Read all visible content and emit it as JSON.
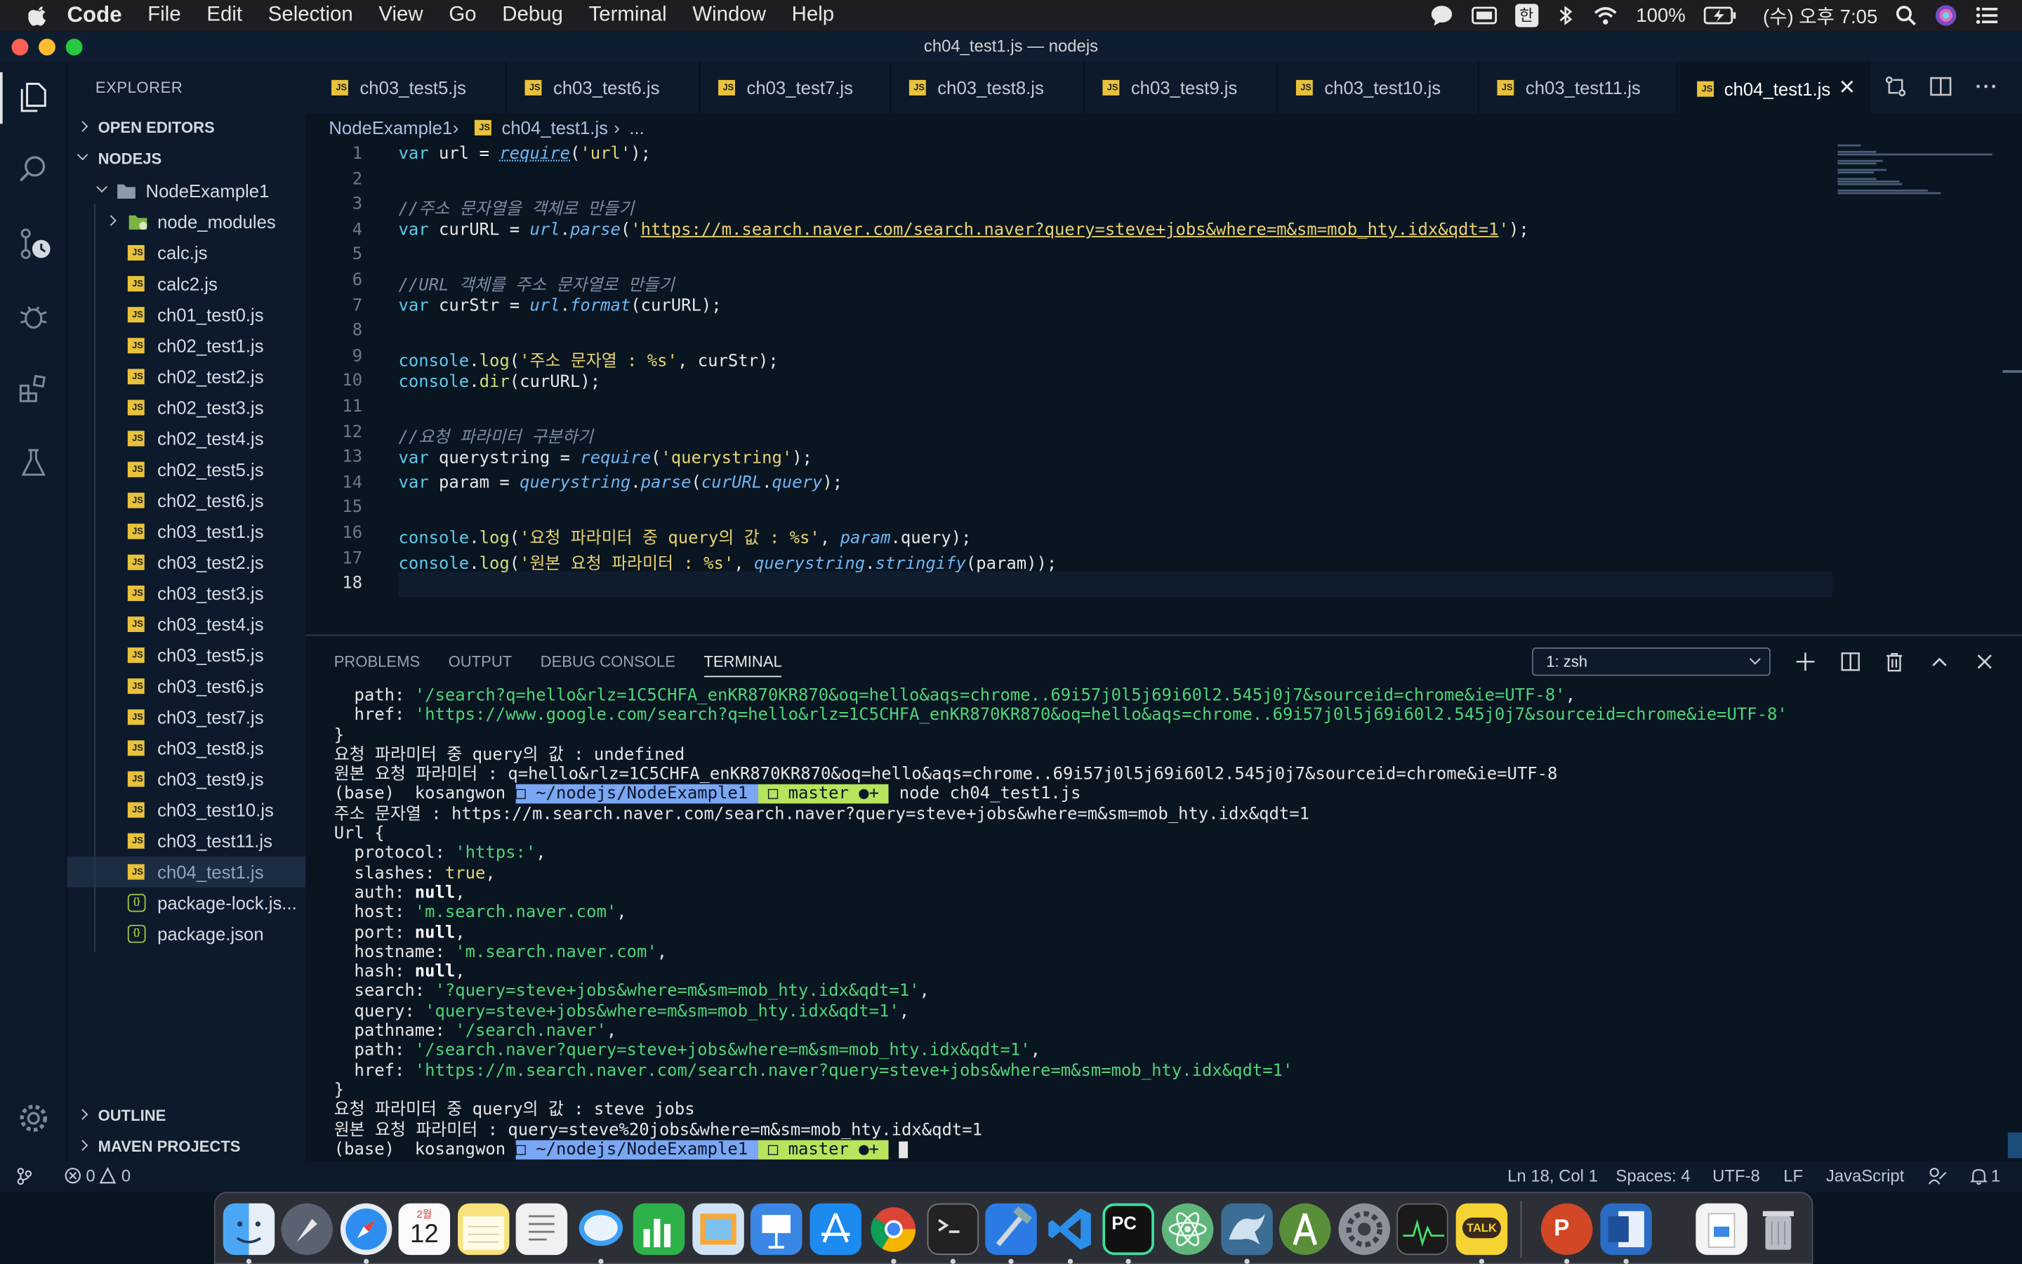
{
  "menubar": {
    "app": "Code",
    "items": [
      "File",
      "Edit",
      "Selection",
      "View",
      "Go",
      "Debug",
      "Terminal",
      "Window",
      "Help"
    ],
    "battery": "100%",
    "datetime": "(수) 오후 7:05",
    "ime": "한"
  },
  "window": {
    "title": "ch04_test1.js — nodejs"
  },
  "explorer": {
    "title": "EXPLORER",
    "open_editors": "OPEN EDITORS",
    "workspace": "NODEJS",
    "project": "NodeExample1",
    "folder": "node_modules",
    "files": [
      "calc.js",
      "calc2.js",
      "ch01_test0.js",
      "ch02_test1.js",
      "ch02_test2.js",
      "ch02_test3.js",
      "ch02_test4.js",
      "ch02_test5.js",
      "ch02_test6.js",
      "ch03_test1.js",
      "ch03_test2.js",
      "ch03_test3.js",
      "ch03_test4.js",
      "ch03_test5.js",
      "ch03_test6.js",
      "ch03_test7.js",
      "ch03_test8.js",
      "ch03_test9.js",
      "ch03_test10.js",
      "ch03_test11.js",
      "ch04_test1.js"
    ],
    "json_files": [
      "package-lock.js...",
      "package.json"
    ],
    "outline": "OUTLINE",
    "maven": "MAVEN PROJECTS"
  },
  "tabs": [
    "ch03_test5.js",
    "ch03_test6.js",
    "ch03_test7.js",
    "ch03_test8.js",
    "ch03_test9.js",
    "ch03_test10.js",
    "ch03_test11.js",
    "ch04_test1.js"
  ],
  "breadcrumb": {
    "project": "NodeExample1",
    "file": "ch04_test1.js",
    "rest": "..."
  },
  "editor": {
    "line_numbers": [
      "1",
      "2",
      "3",
      "4",
      "5",
      "6",
      "7",
      "8",
      "9",
      "10",
      "11",
      "12",
      "13",
      "14",
      "15",
      "16",
      "17",
      "18"
    ]
  },
  "panel": {
    "tabs": [
      "PROBLEMS",
      "OUTPUT",
      "DEBUG CONSOLE",
      "TERMINAL"
    ],
    "terminal_select": "1: zsh"
  },
  "terminal": {
    "prompt_base": "(base)  kosangwon ",
    "prompt_path": "□ ~/nodejs/NodeExample1 ",
    "prompt_git": " □ master ●+ ",
    "command": "node ch04_test1.js",
    "l1_key": "  path: ",
    "l1_val": "'/search?q=hello&rlz=1C5CHFA_enKR870KR870&oq=hello&aqs=chrome..69i57j0l5j69i60l2.545j0j7&sourceid=chrome&ie=UTF-8'",
    "l1_end": ",",
    "l2_key": "  href: ",
    "l2_val": "'https://www.google.com/search?q=hello&rlz=1C5CHFA_enKR870KR870&oq=hello&aqs=chrome..69i57j0l5j69i60l2.545j0j7&sourceid=chrome&ie=UTF-8'",
    "l3": "}",
    "l4": "요청 파라미터 중 query의 값 : undefined",
    "l5": "원본 요청 파라미터 : q=hello&rlz=1C5CHFA_enKR870KR870&oq=hello&aqs=chrome..69i57j0l5j69i60l2.545j0j7&sourceid=chrome&ie=UTF-8",
    "l7": "주소 문자열 : https://m.search.naver.com/search.naver?query=steve+jobs&where=m&sm=mob_hty.idx&qdt=1",
    "l8": "Url {",
    "protocol_k": "  protocol: ",
    "protocol_v": "'https:'",
    "slashes_k": "  slashes: ",
    "slashes_v": "true",
    "auth_k": "  auth: ",
    "null_v": "null",
    "host_k": "  host: ",
    "host_v": "'m.search.naver.com'",
    "port_k": "  port: ",
    "hostname_k": "  hostname: ",
    "hostname_v": "'m.search.naver.com'",
    "hash_k": "  hash: ",
    "search_k": "  search: ",
    "search_v": "'?query=steve+jobs&where=m&sm=mob_hty.idx&qdt=1'",
    "query_k": "  query: ",
    "query_v": "'query=steve+jobs&where=m&sm=mob_hty.idx&qdt=1'",
    "pathname_k": "  pathname: ",
    "pathname_v": "'/search.naver'",
    "path_k": "  path: ",
    "path_v": "'/search.naver?query=steve+jobs&where=m&sm=mob_hty.idx&qdt=1'",
    "href_k": "  href: ",
    "href_v": "'https://m.search.naver.com/search.naver?query=steve+jobs&where=m&sm=mob_hty.idx&qdt=1'",
    "l20": "}",
    "l21": "요청 파라미터 중 query의 값 : steve jobs",
    "l22": "원본 요청 파라미터 : query=steve%20jobs&where=m&sm=mob_hty.idx&qdt=1"
  },
  "status": {
    "errors": "0",
    "warnings": "0",
    "position": "Ln 18, Col 1",
    "spaces": "Spaces: 4",
    "encoding": "UTF-8",
    "eol": "LF",
    "language": "JavaScript",
    "notifications": "1"
  },
  "colors": {
    "accent": "#e8c23a",
    "terminal_green": "#4fd477",
    "prompt_path": "#7aa6f3",
    "prompt_git": "#b8e35d",
    "background": "#0a1522"
  },
  "dock_icons": [
    "finder-icon",
    "launchpad-icon",
    "safari-icon",
    "calendar-icon",
    "notes-icon",
    "textedit-icon",
    "messages-icon",
    "numbers-icon",
    "preview-icon",
    "keynote-icon",
    "app-store-icon",
    "chrome-icon",
    "terminal-icon",
    "xcode-icon",
    "vscode-icon",
    "pycharm-icon",
    "atom-icon",
    "mysql-workbench-icon",
    "android-studio-icon",
    "system-preferences-icon",
    "activity-monitor-icon",
    "kakaotalk-icon",
    "powerpoint-icon",
    "word-icon",
    "file-icon",
    "trash-icon"
  ],
  "dock_calendar": {
    "month": "2월",
    "day": "12"
  }
}
